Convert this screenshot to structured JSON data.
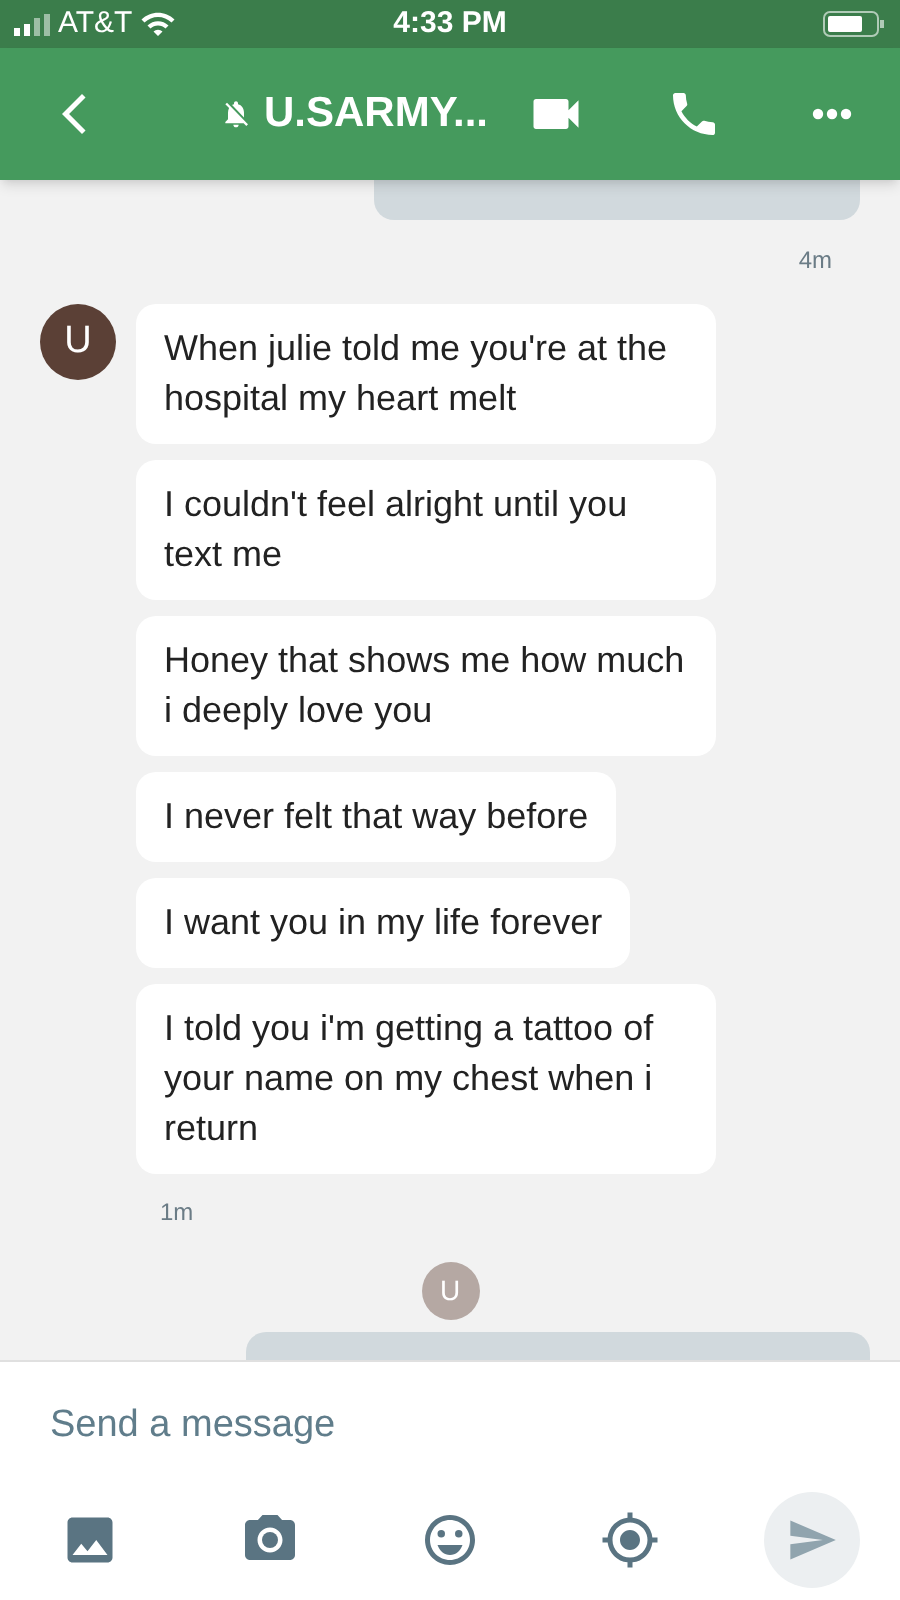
{
  "status_bar": {
    "carrier": "AT&T",
    "time": "4:33 PM"
  },
  "header": {
    "title": "U.SARMY...",
    "muted": true
  },
  "earlier_time": "4m",
  "received": {
    "avatar": "U",
    "messages": [
      "When julie told me you're at the hospital my heart melt",
      "I couldn't feel alright until you text me",
      "Honey that shows me how much i deeply love you",
      "I never felt that way before",
      "I want you in my life forever",
      "I told you i'm getting a tattoo of your name on my chest when i return"
    ],
    "time": "1m"
  },
  "read_avatar": "U",
  "composer": {
    "placeholder": "Send a message"
  }
}
